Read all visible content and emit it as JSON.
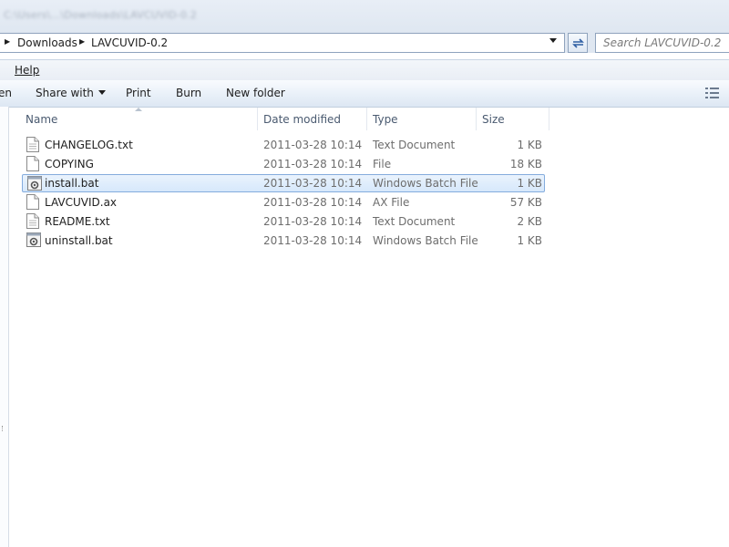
{
  "titlebar": {
    "blurred_text": "C:\\Users\\...\\Downloads\\LAVCUVID-0.2"
  },
  "address": {
    "crumbs": [
      "Downloads",
      "LAVCUVID-0.2"
    ]
  },
  "search": {
    "placeholder": "Search LAVCUVID-0.2"
  },
  "menubar": {
    "help_label": "Help"
  },
  "commandbar": {
    "open_label": "en",
    "share_label": "Share with",
    "print_label": "Print",
    "burn_label": "Burn",
    "newfolder_label": "New folder"
  },
  "columns": {
    "name": "Name",
    "date": "Date modified",
    "type": "Type",
    "size": "Size"
  },
  "files": [
    {
      "name": "CHANGELOG.txt",
      "date": "2011-03-28 10:14",
      "type": "Text Document",
      "size": "1 KB",
      "icon": "text-document-icon"
    },
    {
      "name": "COPYING",
      "date": "2011-03-28 10:14",
      "type": "File",
      "size": "18 KB",
      "icon": "file-icon"
    },
    {
      "name": "install.bat",
      "date": "2011-03-28 10:14",
      "type": "Windows Batch File",
      "size": "1 KB",
      "icon": "batch-file-icon",
      "selected": true
    },
    {
      "name": "LAVCUVID.ax",
      "date": "2011-03-28 10:14",
      "type": "AX File",
      "size": "57 KB",
      "icon": "file-icon"
    },
    {
      "name": "README.txt",
      "date": "2011-03-28 10:14",
      "type": "Text Document",
      "size": "2 KB",
      "icon": "text-document-icon"
    },
    {
      "name": "uninstall.bat",
      "date": "2011-03-28 10:14",
      "type": "Windows Batch File",
      "size": "1 KB",
      "icon": "batch-file-icon"
    }
  ],
  "colors": {
    "selection_border": "#84acdd",
    "selection_fill": "#d6e8fb",
    "commandbar_bg": "#eaf1f9"
  }
}
